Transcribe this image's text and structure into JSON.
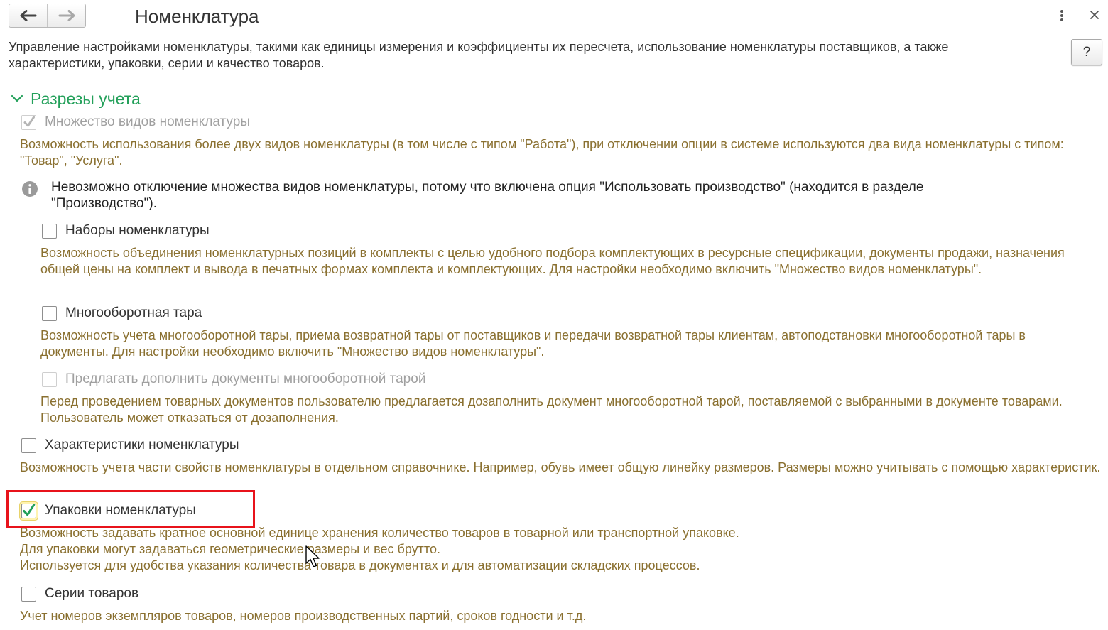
{
  "header": {
    "title": "Номенклатура",
    "back_icon": "arrow-left-icon",
    "forward_icon": "arrow-right-icon",
    "more_icon": "more-vertical-icon",
    "close_icon": "close-icon"
  },
  "description": "Управление настройками номенклатуры, такими как единицы измерения и коэффициенты их пересчета, использование номенклатуры поставщиков, а также характеристики, упаковки, серии и качество товаров.",
  "help_button": {
    "label": "?"
  },
  "section": {
    "title": "Разрезы учета",
    "expanded": true,
    "accent_color": "#23a05a"
  },
  "options": {
    "multiple_kinds": {
      "label": "Множество видов номенклатуры",
      "checked": true,
      "disabled": true,
      "hint": "Возможность использования более двух видов номенклатуры (в том числе с типом \"Работа\"), при отключении опции в системе используются два вида номенклатуры с типом: \"Товар\", \"Услуга\"."
    },
    "info_note": "Невозможно отключение множества видов номенклатуры, потому что включена опция \"Использовать производство\" (находится в разделе \"Производство\").",
    "sets": {
      "label": "Наборы номенклатуры",
      "checked": false,
      "hint": "Возможность объединения номенклатурных позиций в комплекты с целью удобного подбора комплектующих в ресурсные спецификации, документы продажи, назначения общей цены на комплект и вывода в печатных формах комплекта и комплектующих. Для настройки необходимо включить \"Множество видов номенклатуры\"."
    },
    "returnable_containers": {
      "label": "Многооборотная тара",
      "checked": false,
      "hint": "Возможность учета многооборотной тары, приема возвратной тары от поставщиков и передачи возвратной тары клиентам, автоподстановки многооборотной тары в документы. Для настройки необходимо включить \"Множество видов номенклатуры\"."
    },
    "offer_containers": {
      "label": "Предлагать дополнить документы многооборотной тарой",
      "checked": false,
      "disabled": true,
      "hint": "Перед проведением товарных документов пользователю предлагается дозаполнить документ многооборотной тарой, поставляемой с выбранными в документе товарами. Пользователь может отказаться от дозаполнения."
    },
    "characteristics": {
      "label": "Характеристики номенклатуры",
      "checked": false,
      "hint": "Возможность учета части свойств номенклатуры в отдельном справочнике. Например, обувь имеет общую линейку размеров. Размеры можно учитывать с помощью характеристик."
    },
    "packaging": {
      "label": "Упаковки номенклатуры",
      "checked": true,
      "highlighted": true,
      "hint_lines": [
        "Возможность задавать кратное основной единице хранения количество товаров в товарной или транспортной упаковке.",
        "Для упаковки могут задаваться геометрические размеры и вес брутто.",
        "Используется для удобства указания количества товара в документах и для автоматизации складских процессов."
      ]
    },
    "series": {
      "label": "Серии товаров",
      "checked": false,
      "hint": "Учет номеров экземпляров товаров, номеров производственных партий, сроков годности и т.д."
    }
  },
  "colors": {
    "hint_text": "#8a7030",
    "highlight_border": "#e8131b",
    "check_enabled": "#23a05a",
    "check_disabled": "#b5b5b5"
  }
}
